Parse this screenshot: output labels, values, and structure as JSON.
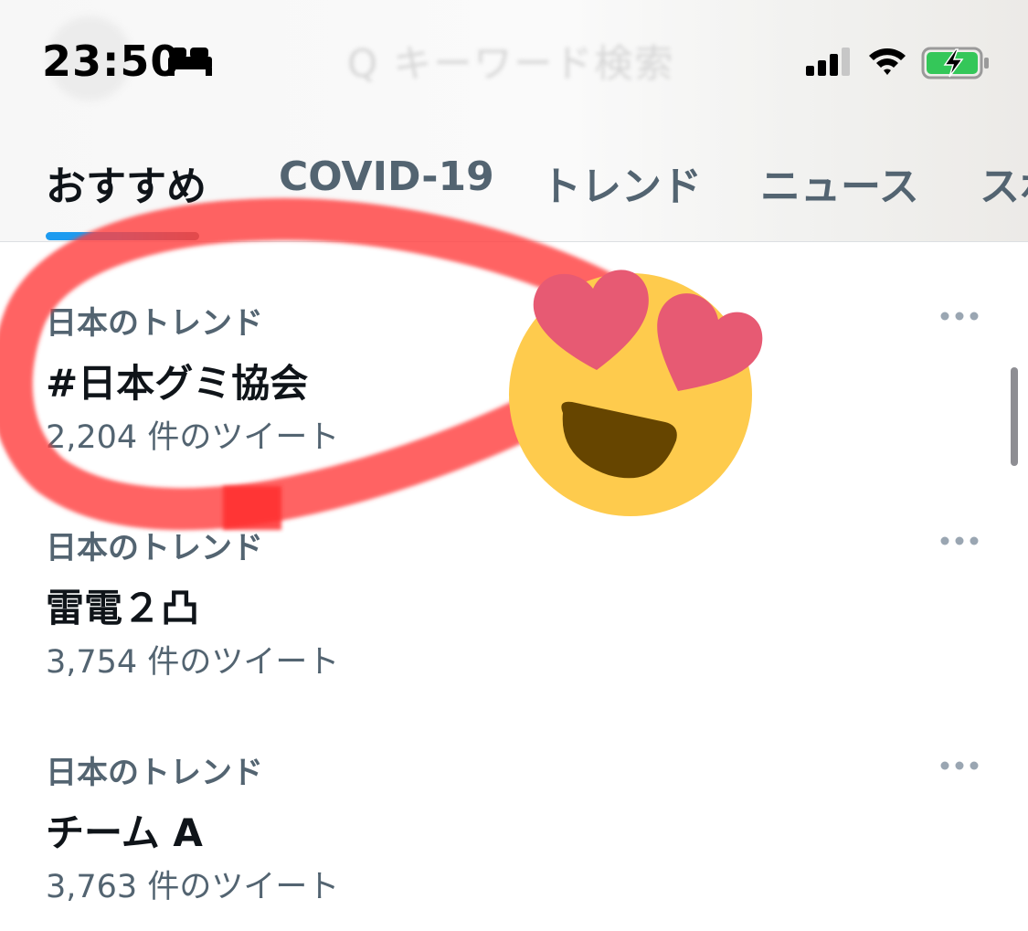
{
  "status_bar": {
    "time": "23:50",
    "sleep_icon": "bed-icon",
    "signal_icon": "cellular-signal-icon",
    "wifi_icon": "wifi-icon",
    "battery_icon": "battery-charging-icon"
  },
  "header": {
    "search_placeholder": "Q キーワード検索"
  },
  "tabs": [
    {
      "label": "おすすめ",
      "active": true
    },
    {
      "label": "COVID-19",
      "active": false
    },
    {
      "label": "トレンド",
      "active": false
    },
    {
      "label": "ニュース",
      "active": false
    },
    {
      "label": "スポ",
      "active": false
    }
  ],
  "trends": [
    {
      "category": "日本のトレンド",
      "title": "#日本グミ協会",
      "count": "2,204 件のツイート"
    },
    {
      "category": "日本のトレンド",
      "title": "雷電２凸",
      "count": "3,754 件のツイート"
    },
    {
      "category": "日本のトレンド",
      "title": "チーム A",
      "count": "3,763 件のツイート"
    }
  ],
  "overlay": {
    "circle_color": "#ff4040",
    "emoji": "smiling-face-with-heart-eyes-icon"
  },
  "colors": {
    "accent": "#1d9bf0",
    "secondary_text": "#536471",
    "primary_text": "#0f1419",
    "battery_fill": "#34c759"
  }
}
